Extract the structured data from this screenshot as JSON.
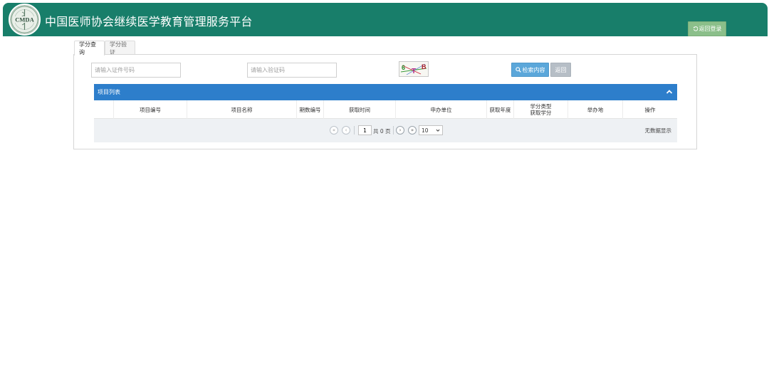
{
  "header": {
    "title": "中国医师协会继续医学教育管理服务平台",
    "logo_text": "CMDA",
    "back_login_label": "返回登录",
    "brand_color": "#187e6a"
  },
  "tabs": [
    {
      "label": "学分查询",
      "active": true
    },
    {
      "label": "学分验证",
      "active": false
    }
  ],
  "search": {
    "id_placeholder": "请输入证件号码",
    "id_value": "",
    "captcha_placeholder": "请输入验证码",
    "captcha_value": "",
    "captcha_image_text": "6 T B",
    "search_label": "检索内容",
    "return_label": "返回"
  },
  "list": {
    "title": "项目列表",
    "header_color": "#2d7ecb",
    "columns": [
      {
        "line1": "",
        "line2": ""
      },
      {
        "line1": "项目编号",
        "line2": ""
      },
      {
        "line1": "项目名称",
        "line2": ""
      },
      {
        "line1": "期数编号",
        "line2": ""
      },
      {
        "line1": "获取时间",
        "line2": ""
      },
      {
        "line1": "申办单位",
        "line2": ""
      },
      {
        "line1": "获取年度",
        "line2": ""
      },
      {
        "line1": "学分类型",
        "line2": "获取学分"
      },
      {
        "line1": "举办地",
        "line2": ""
      },
      {
        "line1": "操作",
        "line2": ""
      }
    ],
    "rows": []
  },
  "pager": {
    "current_page": "1",
    "total_text": "共 0 页",
    "page_size": "10",
    "no_data_text": "无数据显示"
  }
}
